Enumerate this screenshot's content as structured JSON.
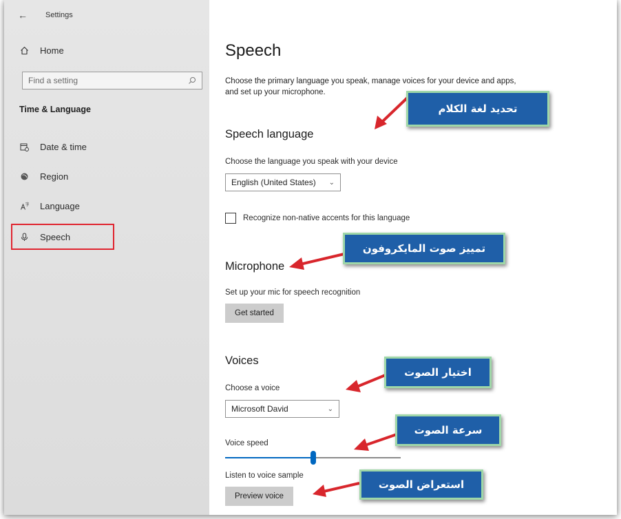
{
  "window": {
    "title": "Settings"
  },
  "sidebar": {
    "home_label": "Home",
    "search_placeholder": "Find a setting",
    "section": "Time & Language",
    "items": [
      {
        "label": "Date & time",
        "icon": "calendar-clock-icon"
      },
      {
        "label": "Region",
        "icon": "globe-icon"
      },
      {
        "label": "Language",
        "icon": "language-icon"
      },
      {
        "label": "Speech",
        "icon": "microphone-icon"
      }
    ],
    "highlight_color": "#e0232e"
  },
  "main": {
    "title": "Speech",
    "description": "Choose the primary language you speak, manage voices for your device and apps, and set up your microphone.",
    "speech_language": {
      "heading": "Speech language",
      "label": "Choose the language you speak with your device",
      "selected": "English (United States)",
      "checkbox_label": "Recognize non-native accents for this language"
    },
    "microphone": {
      "heading": "Microphone",
      "label": "Set up your mic for speech recognition",
      "button": "Get started"
    },
    "voices": {
      "heading": "Voices",
      "choose_label": "Choose a voice",
      "selected_voice": "Microsoft David",
      "speed_label": "Voice speed",
      "speed_fraction": 0.5,
      "sample_label": "Listen to voice sample",
      "preview_button": "Preview voice"
    }
  },
  "callouts": {
    "speech_language": "تحديد لغة الكلام",
    "microphone": "تمييز صوت المايكروفون",
    "choose_voice": "اختيار الصوت",
    "voice_speed": "سرعة الصوت",
    "preview": "استعراض الصوت",
    "fill_color": "#1f5fa8",
    "border_color": "#9fd7a8",
    "arrow_color": "#d8262c"
  },
  "accent_color": "#0067c0"
}
